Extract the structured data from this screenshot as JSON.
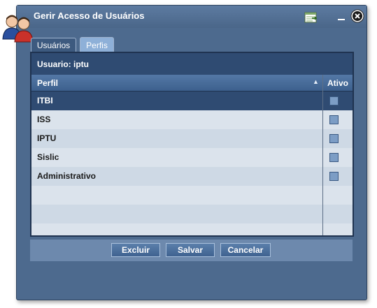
{
  "window": {
    "title": "Gerir Acesso de Usuários"
  },
  "icons": {
    "users": "users-icon",
    "export": "export-icon",
    "minimize": "minimize-icon",
    "close": "close-icon"
  },
  "tabs": [
    {
      "label": "Usuários",
      "active": false
    },
    {
      "label": "Perfis",
      "active": true
    }
  ],
  "panel": {
    "user_label": "Usuario: iptu"
  },
  "grid": {
    "columns": [
      "Perfil",
      "Ativo"
    ],
    "rows": [
      {
        "perfil": "ITBI",
        "ativo": false,
        "selected": true
      },
      {
        "perfil": "ISS",
        "ativo": false,
        "selected": false
      },
      {
        "perfil": "IPTU",
        "ativo": false,
        "selected": false
      },
      {
        "perfil": "Sislic",
        "ativo": false,
        "selected": false
      },
      {
        "perfil": "Administrativo",
        "ativo": false,
        "selected": false
      }
    ]
  },
  "buttons": {
    "excluir": "Excluir",
    "salvar": "Salvar",
    "cancelar": "Cancelar"
  },
  "colors": {
    "window_bg": "#4d6a8e",
    "header_bg": "#3d608d",
    "selected_row": "#2f4b72"
  }
}
